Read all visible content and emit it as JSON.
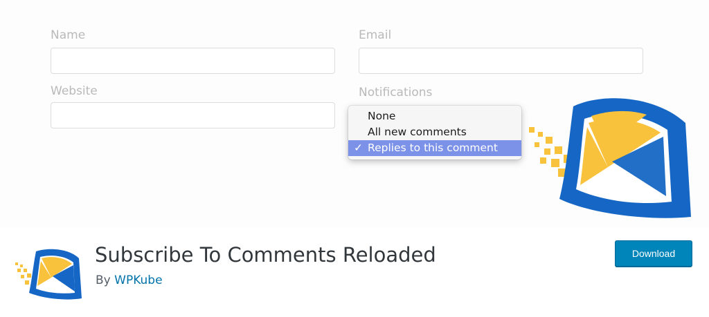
{
  "banner": {
    "form": {
      "name_label": "Name",
      "email_label": "Email",
      "website_label": "Website",
      "notifications_label": "Notifications",
      "name_value": "",
      "email_value": "",
      "website_value": ""
    },
    "notifications_dropdown": {
      "options": [
        {
          "label": "None",
          "selected": false
        },
        {
          "label": "All new comments",
          "selected": false
        },
        {
          "label": "Replies to this comment",
          "selected": true
        }
      ],
      "check_glyph": "✓"
    },
    "logo_icon": "envelope-logo-icon"
  },
  "plugin": {
    "title": "Subscribe To Comments Reloaded",
    "by_prefix": "By",
    "author": "WPKube",
    "download_label": "Download",
    "logo_icon": "envelope-logo-icon"
  },
  "colors": {
    "brand_blue": "#1667c5",
    "brand_yellow": "#f9c23c",
    "button_blue": "#0085ba",
    "link_blue": "#0073aa",
    "selected_option": "#7b92e8"
  }
}
